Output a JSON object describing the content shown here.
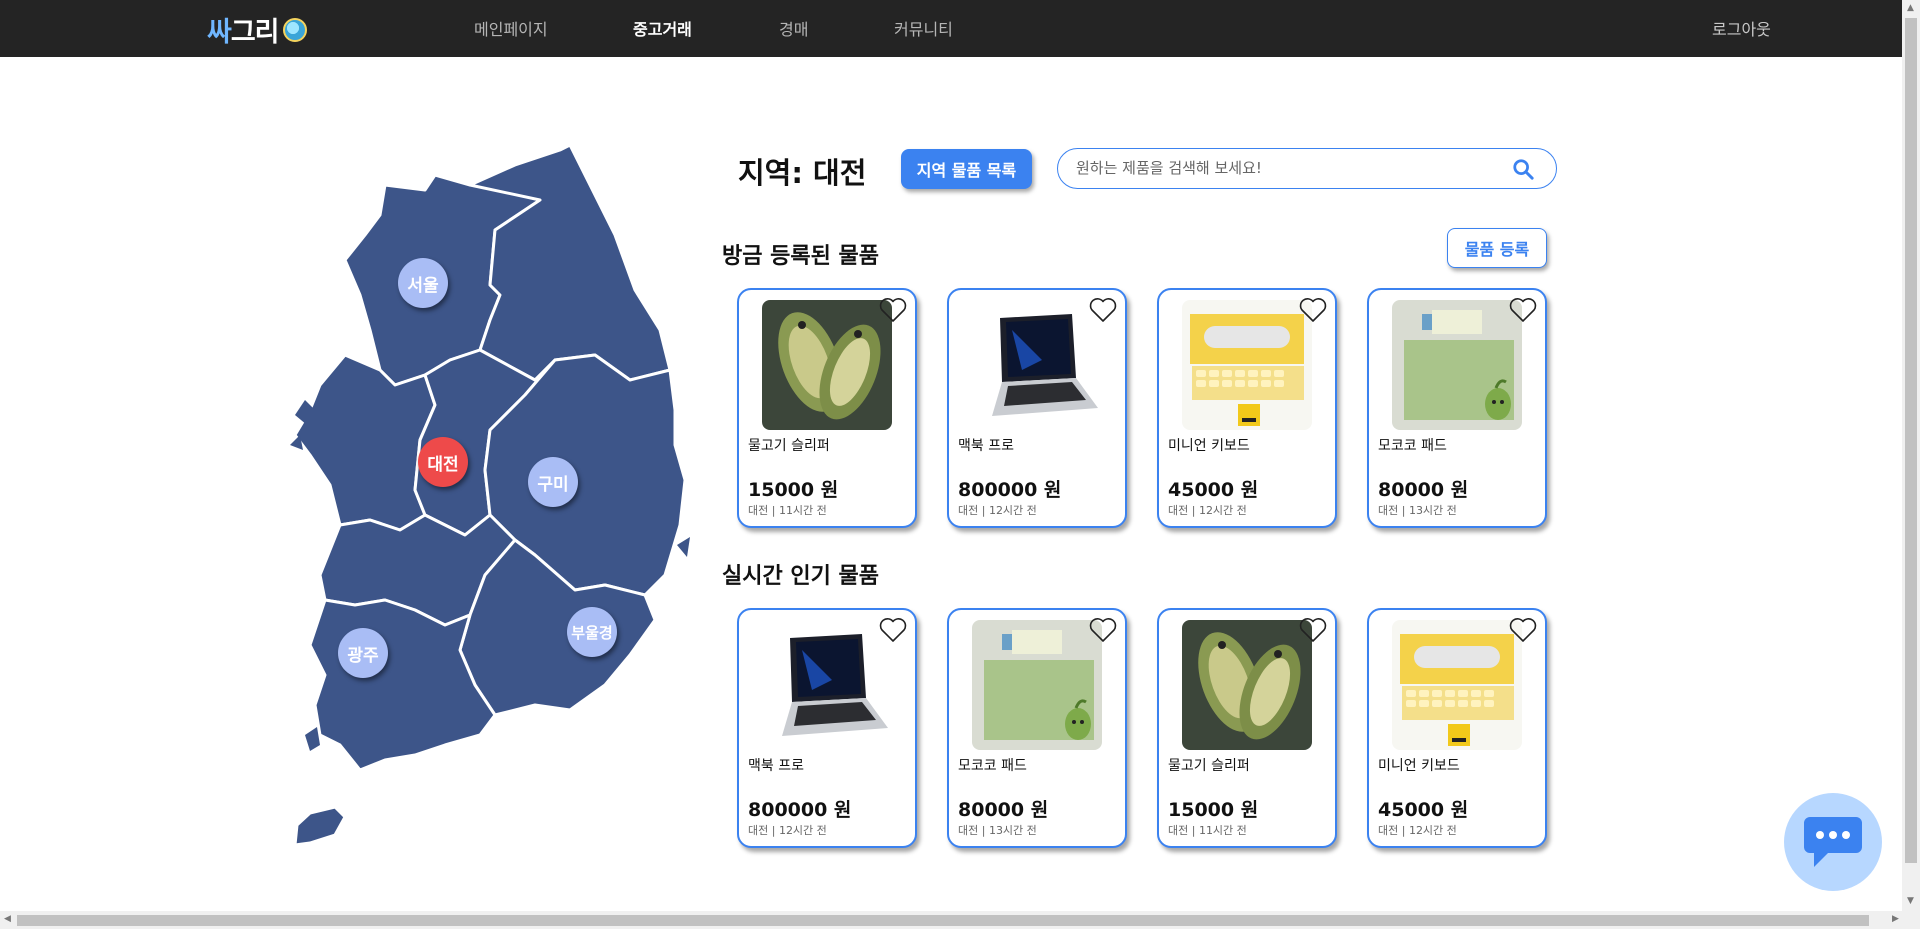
{
  "nav": {
    "logo_text_1": "싸",
    "logo_text_2": "그리",
    "items": [
      {
        "label": "메인페이지",
        "active": false
      },
      {
        "label": "중고거래",
        "active": true
      },
      {
        "label": "경매",
        "active": false
      },
      {
        "label": "커뮤니티",
        "active": false
      }
    ],
    "logout": "로그아웃"
  },
  "map": {
    "map_color": "#3d5589",
    "regions": [
      {
        "label": "서울",
        "selected": false
      },
      {
        "label": "대전",
        "selected": true
      },
      {
        "label": "구미",
        "selected": false
      },
      {
        "label": "광주",
        "selected": false
      },
      {
        "label": "부울경",
        "selected": false
      }
    ]
  },
  "header": {
    "region_title": "지역: 대전",
    "region_list_button": "지역 물품 목록",
    "search_placeholder": "원하는 제품을 검색해 보세요!",
    "search_icon": "search-icon"
  },
  "recent": {
    "title": "방금 등록된 물품",
    "register_button": "물품 등록",
    "items": [
      {
        "name": "물고기 슬리퍼",
        "price": "15000 원",
        "meta": "대전 | 11시간 전",
        "image": "fish-slipper"
      },
      {
        "name": "맥북 프로",
        "price": "800000 원",
        "meta": "대전 | 12시간 전",
        "image": "macbook"
      },
      {
        "name": "미니언 키보드",
        "price": "45000 원",
        "meta": "대전 | 12시간 전",
        "image": "keyboard"
      },
      {
        "name": "모코코 패드",
        "price": "80000 원",
        "meta": "대전 | 13시간 전",
        "image": "mokoko-pad"
      }
    ]
  },
  "popular": {
    "title": "실시간 인기 물품",
    "items": [
      {
        "name": "맥북 프로",
        "price": "800000 원",
        "meta": "대전 | 12시간 전",
        "image": "macbook"
      },
      {
        "name": "모코코 패드",
        "price": "80000 원",
        "meta": "대전 | 13시간 전",
        "image": "mokoko-pad"
      },
      {
        "name": "물고기 슬리퍼",
        "price": "15000 원",
        "meta": "대전 | 11시간 전",
        "image": "fish-slipper"
      },
      {
        "name": "미니언 키보드",
        "price": "45000 원",
        "meta": "대전 | 12시간 전",
        "image": "keyboard"
      }
    ]
  },
  "colors": {
    "accent": "#3b82f0",
    "selected_region": "#ee4a4a",
    "region_pin": "#a9bdf5",
    "topbar": "#242424",
    "chat_button": "#b7d7ff"
  },
  "chat": {
    "icon": "chat-bubble-icon"
  }
}
